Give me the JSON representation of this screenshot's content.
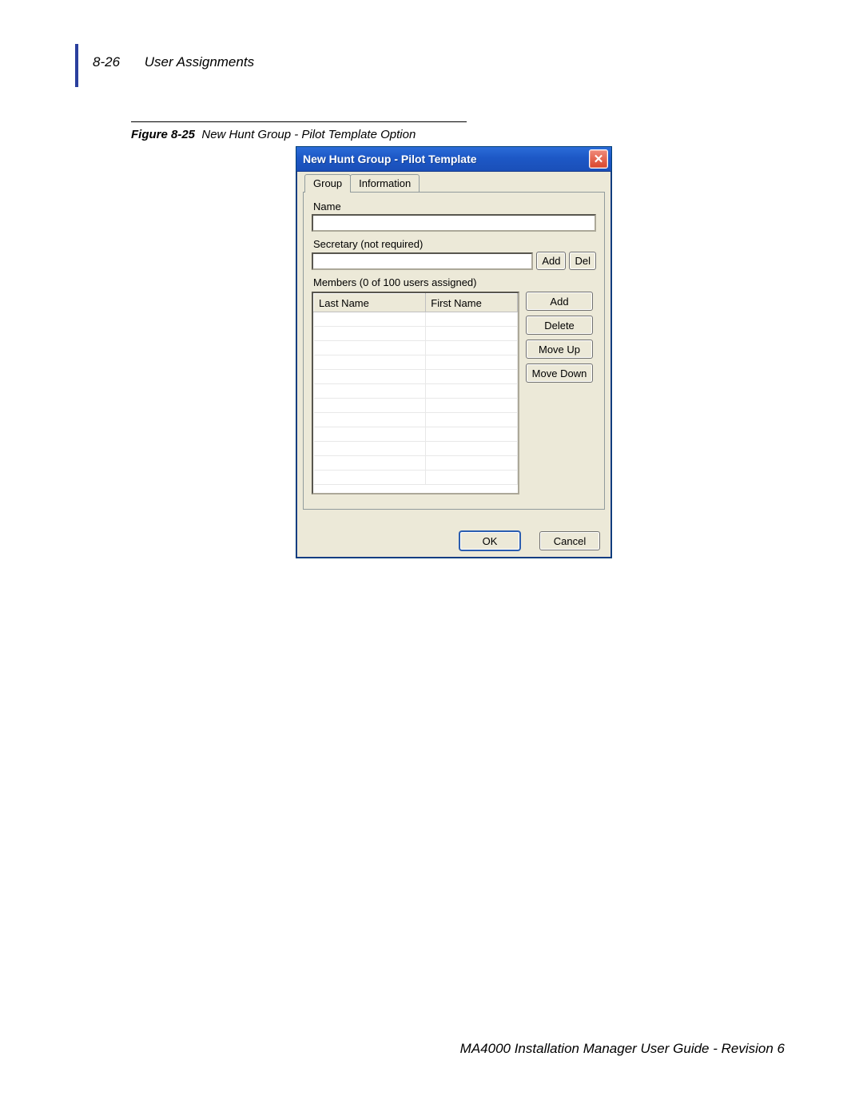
{
  "header": {
    "page_no": "8-26",
    "section": "User Assignments"
  },
  "caption": {
    "fig_label": "Figure 8-25",
    "fig_text": "New Hunt Group - Pilot Template Option"
  },
  "dialog": {
    "title": "New Hunt Group - Pilot Template",
    "tabs": {
      "group": "Group",
      "information": "Information"
    },
    "labels": {
      "name": "Name",
      "secretary": "Secretary (not required)",
      "members": "Members (0 of 100 users assigned)"
    },
    "buttons": {
      "sec_add": "Add",
      "sec_del": "Del",
      "mem_add": "Add",
      "mem_delete": "Delete",
      "mem_up": "Move Up",
      "mem_down": "Move Down",
      "ok": "OK",
      "cancel": "Cancel"
    },
    "columns": {
      "last": "Last Name",
      "first": "First Name"
    },
    "name_value": "",
    "secretary_value": ""
  },
  "footer": "MA4000 Installation Manager User Guide - Revision 6"
}
